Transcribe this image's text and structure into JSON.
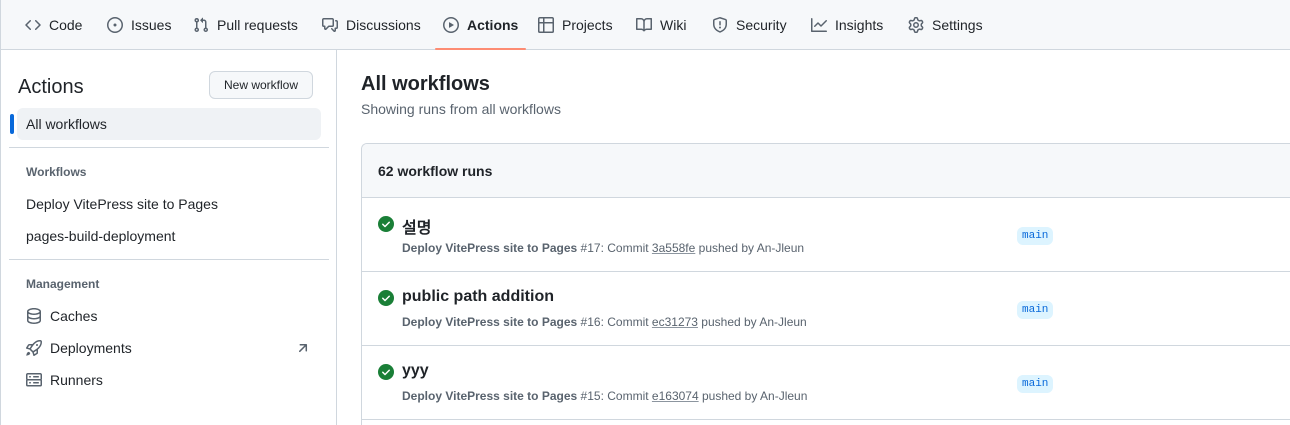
{
  "repo_nav": {
    "tabs": [
      {
        "label": "Code",
        "icon": "code-icon"
      },
      {
        "label": "Issues",
        "icon": "issue-opened-icon"
      },
      {
        "label": "Pull requests",
        "icon": "git-pull-request-icon"
      },
      {
        "label": "Discussions",
        "icon": "comment-discussion-icon"
      },
      {
        "label": "Actions",
        "icon": "play-icon",
        "selected": true
      },
      {
        "label": "Projects",
        "icon": "table-icon"
      },
      {
        "label": "Wiki",
        "icon": "book-icon"
      },
      {
        "label": "Security",
        "icon": "shield-icon"
      },
      {
        "label": "Insights",
        "icon": "graph-icon"
      },
      {
        "label": "Settings",
        "icon": "gear-icon"
      }
    ],
    "selected_underline_color": "#fd8c73"
  },
  "sidebar": {
    "title": "Actions",
    "new_workflow_label": "New workflow",
    "all_workflows_label": "All workflows",
    "workflows_heading": "Workflows",
    "workflows": [
      {
        "label": "Deploy VitePress site to Pages"
      },
      {
        "label": "pages-build-deployment"
      }
    ],
    "management_heading": "Management",
    "management": [
      {
        "label": "Caches",
        "icon": "database-icon"
      },
      {
        "label": "Deployments",
        "icon": "rocket-icon",
        "external_icon": "arrow-up-right-icon"
      },
      {
        "label": "Runners",
        "icon": "server-icon"
      }
    ]
  },
  "main": {
    "title": "All workflows",
    "subtitle": "Showing runs from all workflows",
    "runs_count_label": "62 workflow runs",
    "runs": [
      {
        "title": "설명",
        "status": "success",
        "workflow": "Deploy VitePress site to Pages",
        "run_number": "#17",
        "commit_prefix": ": Commit ",
        "sha": "3a558fe",
        "pushed_by": " pushed by An-Jleun",
        "branch": "main"
      },
      {
        "title": "public path addition",
        "status": "success",
        "workflow": "Deploy VitePress site to Pages",
        "run_number": "#16",
        "commit_prefix": ": Commit ",
        "sha": "ec31273",
        "pushed_by": " pushed by An-Jleun",
        "branch": "main"
      },
      {
        "title": "yyy",
        "status": "success",
        "workflow": "Deploy VitePress site to Pages",
        "run_number": "#15",
        "commit_prefix": ": Commit ",
        "sha": "e163074",
        "pushed_by": " pushed by An-Jleun",
        "branch": "main"
      }
    ],
    "colors": {
      "success": "#1a7f37",
      "accent": "#0969da",
      "branch_bg": "#ddf4ff"
    }
  }
}
